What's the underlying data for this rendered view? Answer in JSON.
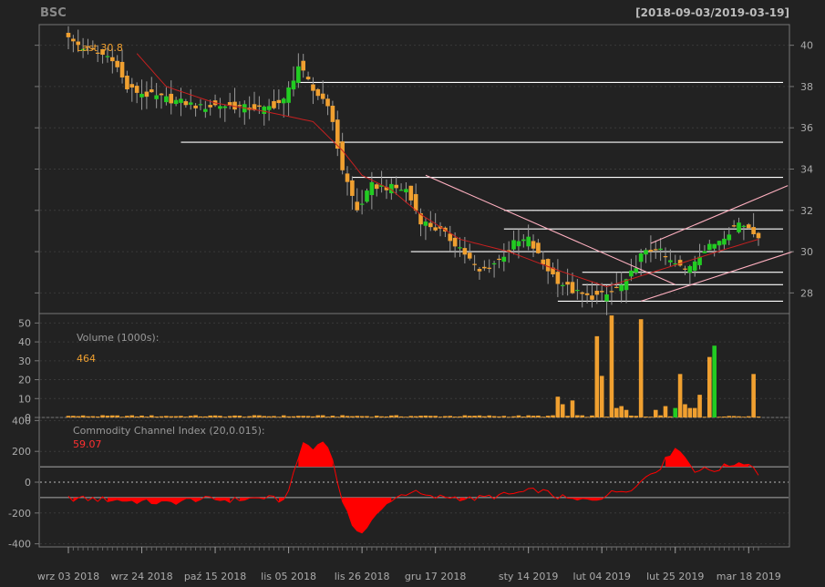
{
  "header": {
    "symbol": "BSC",
    "date_range": "[2018-09-03/2019-03-19]"
  },
  "price_panel": {
    "last_label": "Last 30.8",
    "y_ticks": [
      28,
      30,
      32,
      34,
      36,
      38,
      40
    ],
    "ylim": [
      27.0,
      41.0
    ]
  },
  "volume_panel": {
    "label": "Volume (1000s):",
    "value": "464",
    "y_ticks": [
      0,
      10,
      20,
      30,
      40,
      50
    ],
    "ylim": [
      0,
      55
    ]
  },
  "cci_panel": {
    "label": "Commodity Channel Index (20,0.015):",
    "value": "59.07",
    "y_ticks": [
      -400,
      -200,
      0,
      200,
      400
    ],
    "ylim": [
      -420,
      420
    ],
    "bands": [
      100,
      -100
    ]
  },
  "x_axis": {
    "labels": [
      "wrz 03 2018",
      "wrz 24 2018",
      "paź 15 2018",
      "lis 05 2018",
      "lis 26 2018",
      "gru 17 2018",
      "sty 14 2019",
      "lut 04 2019",
      "lut 25 2019",
      "mar 18 2019"
    ],
    "label_index": [
      0,
      15,
      30,
      45,
      60,
      75,
      94,
      109,
      124,
      139
    ]
  },
  "colors": {
    "background": "#222222",
    "grid": "#3a3a3a",
    "frame": "#777777",
    "up": "#22cc22",
    "down": "#f0a030",
    "ma": "#c82020",
    "cci": "#ff0000",
    "trend": "#ffb0c0",
    "hline": "#ffffff",
    "text": "#aaaaaa",
    "highlight": "#f0a030"
  },
  "chart_data": {
    "type": "ohlc",
    "start": "2018-09-03",
    "end": "2019-03-19",
    "anchors": [
      [
        0,
        40.3
      ],
      [
        3,
        39.9
      ],
      [
        6,
        39.6
      ],
      [
        9,
        39.4
      ],
      [
        12,
        37.9
      ],
      [
        16,
        37.6
      ],
      [
        20,
        37.4
      ],
      [
        24,
        37.2
      ],
      [
        27,
        37.0
      ],
      [
        31,
        37.1
      ],
      [
        35,
        37.0
      ],
      [
        40,
        36.9
      ],
      [
        44,
        37.3
      ],
      [
        47,
        39.0
      ],
      [
        50,
        37.8
      ],
      [
        53,
        37.2
      ],
      [
        56,
        34.0
      ],
      [
        59,
        32.0
      ],
      [
        62,
        33.2
      ],
      [
        66,
        33.1
      ],
      [
        69,
        33.0
      ],
      [
        72,
        31.5
      ],
      [
        76,
        31.0
      ],
      [
        80,
        30.2
      ],
      [
        84,
        29.0
      ],
      [
        88,
        29.6
      ],
      [
        91,
        30.4
      ],
      [
        94,
        30.6
      ],
      [
        97,
        29.4
      ],
      [
        100,
        28.6
      ],
      [
        103,
        28.1
      ],
      [
        106,
        27.8
      ],
      [
        110,
        27.9
      ],
      [
        114,
        28.5
      ],
      [
        117,
        29.8
      ],
      [
        120,
        30.2
      ],
      [
        123,
        29.5
      ],
      [
        126,
        29.1
      ],
      [
        129,
        29.9
      ],
      [
        132,
        30.4
      ],
      [
        135,
        31.0
      ],
      [
        137,
        31.4
      ],
      [
        139,
        31.2
      ],
      [
        141,
        30.8
      ]
    ],
    "moving_average": [
      [
        14,
        39.6
      ],
      [
        20,
        38.0
      ],
      [
        30,
        37.2
      ],
      [
        40,
        36.8
      ],
      [
        50,
        36.3
      ],
      [
        56,
        34.9
      ],
      [
        60,
        33.7
      ],
      [
        66,
        33.0
      ],
      [
        72,
        31.8
      ],
      [
        80,
        30.6
      ],
      [
        90,
        30.0
      ],
      [
        100,
        29.1
      ],
      [
        110,
        28.3
      ],
      [
        118,
        28.9
      ],
      [
        126,
        29.5
      ],
      [
        134,
        30.1
      ],
      [
        141,
        30.6
      ]
    ],
    "volume_spikes": [
      [
        100,
        11
      ],
      [
        101,
        7
      ],
      [
        103,
        9
      ],
      [
        108,
        43
      ],
      [
        109,
        22
      ],
      [
        111,
        54
      ],
      [
        112,
        5
      ],
      [
        113,
        6
      ],
      [
        114,
        4
      ],
      [
        117,
        52
      ],
      [
        120,
        4
      ],
      [
        122,
        6
      ],
      [
        124,
        5
      ],
      [
        125,
        23
      ],
      [
        126,
        7
      ],
      [
        127,
        5
      ],
      [
        128,
        5
      ],
      [
        129,
        12
      ],
      [
        131,
        32
      ],
      [
        132,
        38
      ],
      [
        140,
        23
      ],
      [
        141,
        0.5
      ]
    ],
    "volume_up_days": [
      124,
      132
    ],
    "cci": [
      [
        0,
        -105
      ],
      [
        10,
        -115
      ],
      [
        20,
        -135
      ],
      [
        26,
        -110
      ],
      [
        34,
        -115
      ],
      [
        40,
        -100
      ],
      [
        44,
        -120
      ],
      [
        46,
        45
      ],
      [
        48,
        260
      ],
      [
        50,
        210
      ],
      [
        52,
        280
      ],
      [
        54,
        150
      ],
      [
        56,
        -140
      ],
      [
        58,
        -270
      ],
      [
        60,
        -330
      ],
      [
        62,
        -250
      ],
      [
        66,
        -110
      ],
      [
        70,
        -60
      ],
      [
        74,
        -100
      ],
      [
        78,
        -95
      ],
      [
        82,
        -110
      ],
      [
        86,
        -95
      ],
      [
        90,
        -80
      ],
      [
        94,
        -60
      ],
      [
        96,
        -50
      ],
      [
        100,
        -95
      ],
      [
        104,
        -120
      ],
      [
        108,
        -105
      ],
      [
        112,
        -60
      ],
      [
        116,
        -30
      ],
      [
        118,
        40
      ],
      [
        121,
        100
      ],
      [
        124,
        230
      ],
      [
        126,
        160
      ],
      [
        128,
        80
      ],
      [
        132,
        80
      ],
      [
        136,
        120
      ],
      [
        138,
        130
      ],
      [
        140,
        100
      ],
      [
        141,
        59
      ]
    ],
    "horizontal_lines": [
      {
        "y": 38.2,
        "from": 47,
        "to": 141
      },
      {
        "y": 35.3,
        "from": 23,
        "to": 141
      },
      {
        "y": 33.6,
        "from": 58,
        "to": 141
      },
      {
        "y": 32.0,
        "from": 89,
        "to": 141
      },
      {
        "y": 31.1,
        "from": 89,
        "to": 141
      },
      {
        "y": 30.0,
        "from": 70,
        "to": 141
      },
      {
        "y": 29.0,
        "from": 105,
        "to": 141
      },
      {
        "y": 28.4,
        "from": 105,
        "to": 141
      },
      {
        "y": 27.6,
        "from": 100,
        "to": 141
      }
    ],
    "trend_lines": [
      {
        "x1": 73,
        "y1": 33.7,
        "x2": 124,
        "y2": 28.4
      },
      {
        "x1": 117,
        "y1": 27.6,
        "x2": 148,
        "y2": 30.0
      },
      {
        "x1": 119,
        "y1": 30.4,
        "x2": 147,
        "y2": 33.2
      }
    ]
  }
}
